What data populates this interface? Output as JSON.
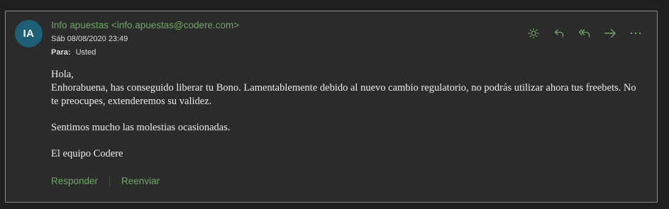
{
  "message": {
    "avatar_initials": "IA",
    "sender": "Info apuestas <info.apuestas@codere.com>",
    "date": "Sáb 08/08/2020 23:49",
    "to_label": "Para:",
    "to_value": "Usted",
    "body": {
      "greeting": "Hola,",
      "line1": "Enhorabuena, has conseguido liberar tu Bono.  Lamentablemente debido al nuevo cambio regulatorio, no podrás utilizar ahora tus freebets. No te preocupes, extenderemos su validez.",
      "line2": "Sentimos mucho las molestias ocasionadas.",
      "signature": "El equipo Codere"
    }
  },
  "toolbar": {
    "icons": [
      "sun-icon",
      "reply-icon",
      "reply-all-icon",
      "forward-icon",
      "more-icon"
    ]
  },
  "actions": {
    "reply_label": "Responder",
    "forward_label": "Reenviar"
  },
  "colors": {
    "accent": "#6fa865",
    "avatar_bg": "#1e5f77",
    "card_bg": "#2b2b2b",
    "page_bg": "#1f1f1f"
  }
}
